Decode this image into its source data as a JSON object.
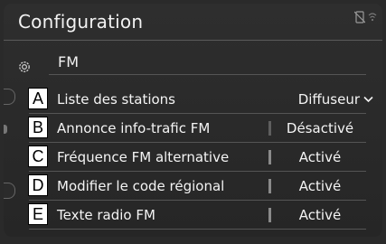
{
  "header": {
    "title": "Configuration"
  },
  "status_icons": [
    "phone-off-icon",
    "wifi-icon"
  ],
  "section": {
    "label": "FM",
    "icon": "gear-icon"
  },
  "rows": [
    {
      "badge": "A",
      "label": "Liste des stations",
      "value": "Diffuseur",
      "control": "dropdown"
    },
    {
      "badge": "B",
      "label": "Annonce info-trafic FM",
      "value": "Désactivé",
      "control": "toggle"
    },
    {
      "badge": "C",
      "label": "Fréquence FM alternative",
      "value": "Activé",
      "control": "toggle"
    },
    {
      "badge": "D",
      "label": "Modifier le code régional",
      "value": "Activé",
      "control": "toggle"
    },
    {
      "badge": "E",
      "label": "Texte radio FM",
      "value": "Activé",
      "control": "toggle"
    }
  ]
}
